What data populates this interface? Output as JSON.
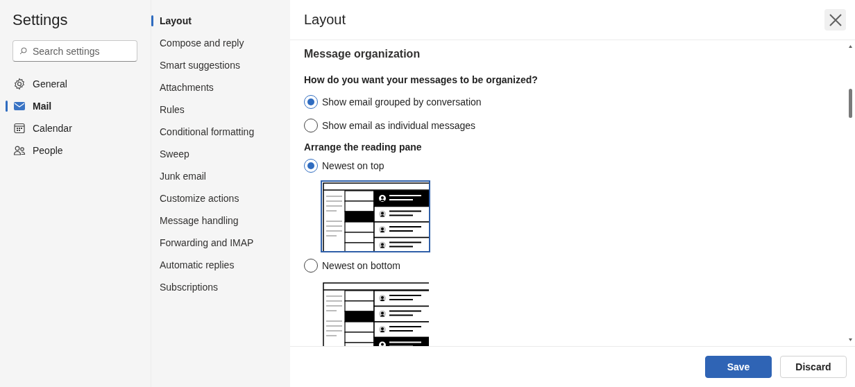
{
  "sidebar": {
    "title": "Settings",
    "search": {
      "placeholder": "Search settings"
    },
    "items": [
      {
        "label": "General",
        "kind": "gear",
        "selected": false
      },
      {
        "label": "Mail",
        "kind": "mail",
        "selected": true
      },
      {
        "label": "Calendar",
        "kind": "calendar",
        "selected": false
      },
      {
        "label": "People",
        "kind": "people",
        "selected": false
      }
    ]
  },
  "subnav": {
    "items": [
      {
        "label": "Layout",
        "selected": true
      },
      {
        "label": "Compose and reply",
        "selected": false
      },
      {
        "label": "Smart suggestions",
        "selected": false
      },
      {
        "label": "Attachments",
        "selected": false
      },
      {
        "label": "Rules",
        "selected": false
      },
      {
        "label": "Conditional formatting",
        "selected": false
      },
      {
        "label": "Sweep",
        "selected": false
      },
      {
        "label": "Junk email",
        "selected": false
      },
      {
        "label": "Customize actions",
        "selected": false
      },
      {
        "label": "Message handling",
        "selected": false
      },
      {
        "label": "Forwarding and IMAP",
        "selected": false
      },
      {
        "label": "Automatic replies",
        "selected": false
      },
      {
        "label": "Subscriptions",
        "selected": false
      }
    ]
  },
  "panel": {
    "title": "Layout",
    "section": "Message organization",
    "groups": [
      {
        "heading": "How do you want your messages to be organized?",
        "options": [
          {
            "label": "Show email grouped by conversation",
            "selected": true
          },
          {
            "label": "Show email as individual messages",
            "selected": false
          }
        ]
      },
      {
        "heading": "Arrange the reading pane",
        "options": [
          {
            "label": "Newest on top",
            "selected": true,
            "kind": "top"
          },
          {
            "label": "Newest on bottom",
            "selected": false,
            "kind": "bottom"
          }
        ]
      }
    ],
    "buttons": [
      {
        "label": "Save",
        "kind": "primary"
      },
      {
        "label": "Discard",
        "kind": "secondary"
      }
    ]
  }
}
